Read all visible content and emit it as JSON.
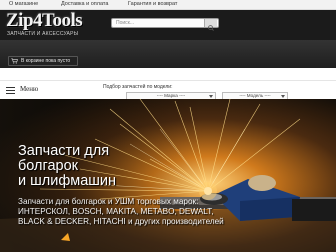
{
  "topnav": {
    "items": [
      "О магазине",
      "Доставка и оплата",
      "Гарантия и возврат"
    ]
  },
  "logo": {
    "main": "Zip4Tools",
    "sub": "ЗАПЧАСТИ И АКСЕССУАРЫ"
  },
  "search": {
    "placeholder": "Поиск...",
    "icon": "search-icon"
  },
  "cart": {
    "icon": "cart-icon",
    "text": "В корзине пока пусто"
  },
  "menu": {
    "label": "Меню",
    "icon": "hamburger-icon"
  },
  "filter": {
    "label": "Подбор запчастей по модели:",
    "brand_select": "---- Марка ----",
    "model_select": "---- Модель ----"
  },
  "hero": {
    "title_lines": [
      "Запчасти для",
      "болгарок",
      "и шлифмашин"
    ],
    "subtitle_lines": [
      "Запчасти для болгарок и УШМ торговых марок:",
      "ИНТЕРСКОЛ, BOSCH, MAKITA, METABO, DEWALT,",
      "BLACK & DECKER, HITACHI и других производителей"
    ]
  },
  "colors": {
    "header_bg": "#1b1b1b",
    "topnav_bg": "#f2f2f2",
    "hero_accent": "#f7a627"
  }
}
